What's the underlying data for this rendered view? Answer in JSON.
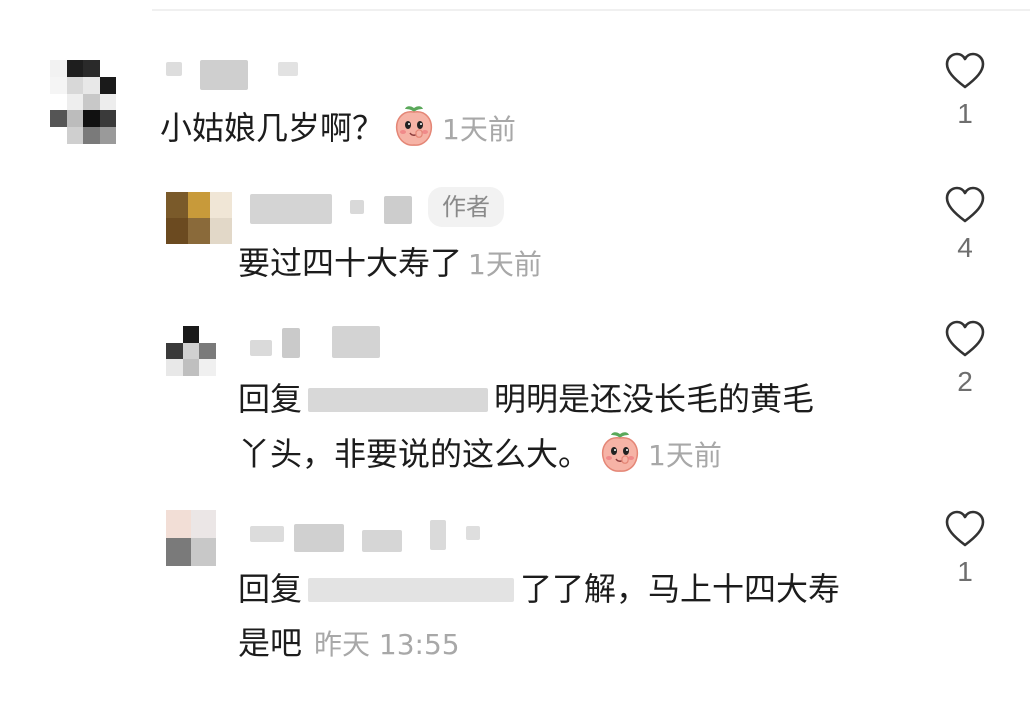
{
  "comments": [
    {
      "text": "小姑娘几岁啊？",
      "time": "1天前",
      "likes": "1",
      "emoji": "peach-face-emoji"
    },
    {
      "badge": "作者",
      "text": "要过四十大寿了",
      "time": "1天前",
      "likes": "4"
    },
    {
      "reply_prefix": "回复",
      "text_line1": "明明是还没长毛的黄毛",
      "text_line2": "丫头，非要说的这么大。",
      "time": "1天前",
      "likes": "2",
      "emoji": "peach-face-emoji"
    },
    {
      "reply_prefix": "回复",
      "text_line1": "了了解，马上十四大寿",
      "text_line2": "是吧",
      "time": "昨天 13:55",
      "likes": "1"
    }
  ],
  "icons": {
    "like": "heart-outline-icon",
    "emoji": "peach-face-emoji"
  },
  "colors": {
    "text": "#1c1c1c",
    "time": "#a8a8a8",
    "count": "#6e6e6e",
    "badge_bg": "#f2f2f2"
  }
}
